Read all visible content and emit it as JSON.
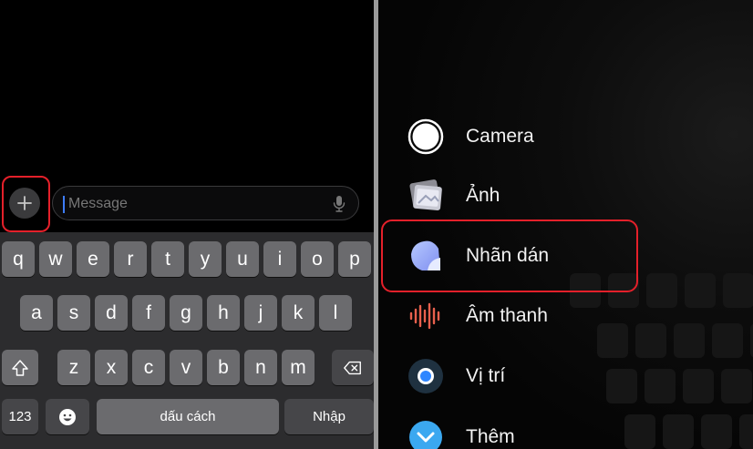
{
  "composer": {
    "placeholder": "Message",
    "plus_icon": "plus-icon",
    "mic_icon": "microphone-icon"
  },
  "keyboard": {
    "row1": [
      "q",
      "w",
      "e",
      "r",
      "t",
      "y",
      "u",
      "i",
      "o",
      "p"
    ],
    "row2": [
      "a",
      "s",
      "d",
      "f",
      "g",
      "h",
      "j",
      "k",
      "l"
    ],
    "row3": [
      "z",
      "x",
      "c",
      "v",
      "b",
      "n",
      "m"
    ],
    "shift_icon": "shift-icon",
    "delete_icon": "backspace-icon",
    "numbers_label": "123",
    "emoji_icon": "emoji-icon",
    "space_label": "dấu cách",
    "return_label": "Nhập"
  },
  "attach_menu": {
    "items": [
      {
        "label": "Camera",
        "icon": "camera-icon"
      },
      {
        "label": "Ảnh",
        "icon": "photos-icon"
      },
      {
        "label": "Nhãn dán",
        "icon": "stickers-icon",
        "highlighted": true
      },
      {
        "label": "Âm thanh",
        "icon": "audio-waveform-icon"
      },
      {
        "label": "Vị trí",
        "icon": "location-icon"
      },
      {
        "label": "Thêm",
        "icon": "more-chevron-icon"
      }
    ]
  },
  "colors": {
    "highlight": "#e4202a",
    "keyboard_bg": "#2c2c2e",
    "key_bg": "#6b6b6e",
    "caret": "#3d7dff"
  }
}
